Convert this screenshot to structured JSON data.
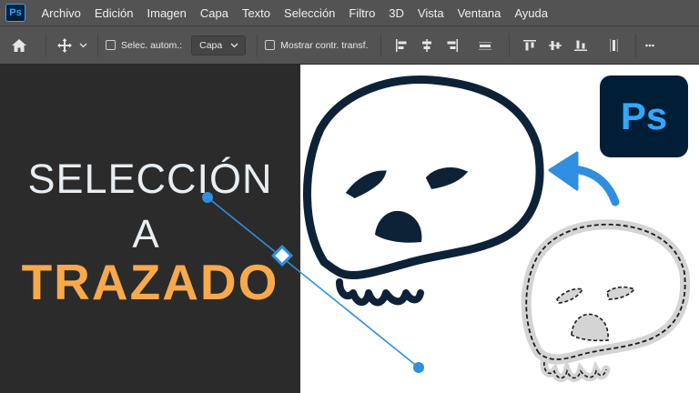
{
  "app": {
    "logo_text": "Ps"
  },
  "menu": [
    "Archivo",
    "Edición",
    "Imagen",
    "Capa",
    "Texto",
    "Selección",
    "Filtro",
    "3D",
    "Vista",
    "Ventana",
    "Ayuda"
  ],
  "options_bar": {
    "auto_select_label": "Selec. autom.:",
    "auto_select_value": "Capa",
    "show_transform_label": "Mostrar contr. transf."
  },
  "headline": {
    "line1": "SELECCIÓN",
    "line2": "A",
    "line3": "TRAZADO"
  },
  "brand_logo": {
    "text": "Ps"
  },
  "colors": {
    "accent_blue": "#2f8ee0",
    "title_orange": "#f9a94b",
    "skull_dark": "#0d2236",
    "ps_bg": "#001e36",
    "ps_text": "#31a8ff"
  }
}
